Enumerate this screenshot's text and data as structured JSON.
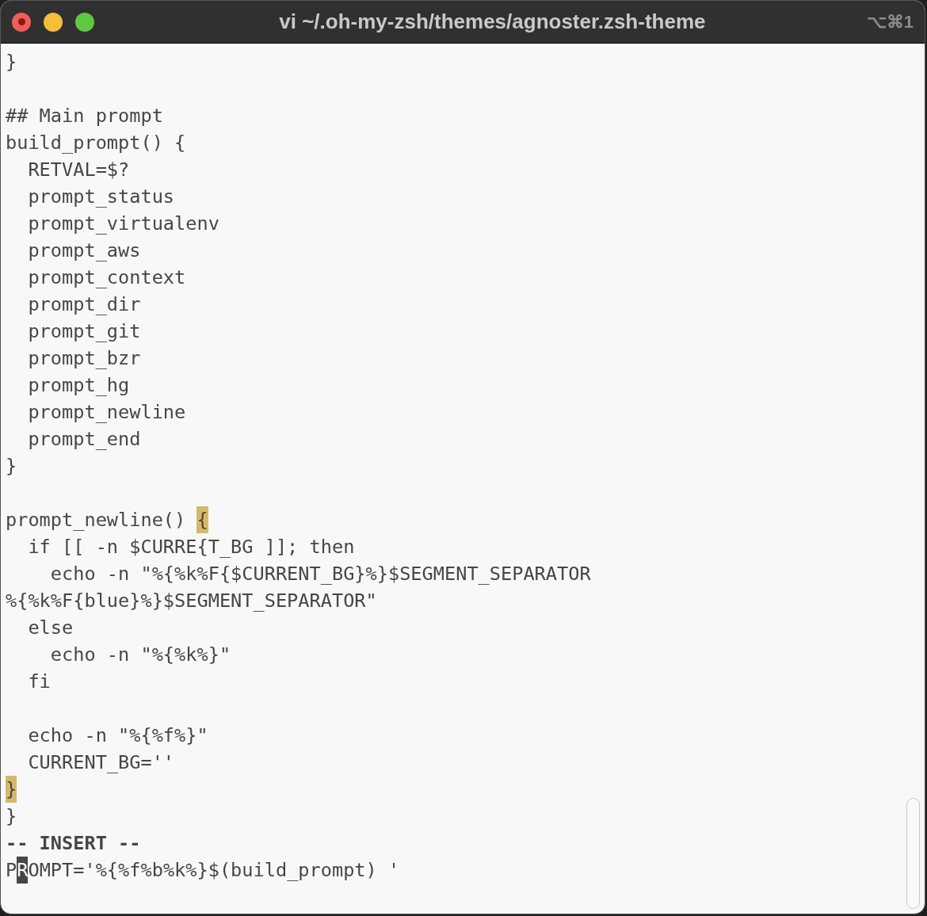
{
  "window": {
    "title": "vi ~/.oh-my-zsh/themes/agnoster.zsh-theme",
    "shortcut": "⌥⌘1"
  },
  "editor": {
    "lines": [
      {
        "kind": "code",
        "segments": [
          {
            "text": "}"
          }
        ]
      },
      {
        "kind": "blank"
      },
      {
        "kind": "code",
        "segments": [
          {
            "text": "## Main prompt"
          }
        ]
      },
      {
        "kind": "code",
        "segments": [
          {
            "text": "build_prompt() {"
          }
        ]
      },
      {
        "kind": "code",
        "segments": [
          {
            "text": "  RETVAL=$?"
          }
        ]
      },
      {
        "kind": "code",
        "segments": [
          {
            "text": "  prompt_status"
          }
        ]
      },
      {
        "kind": "code",
        "segments": [
          {
            "text": "  prompt_virtualenv"
          }
        ]
      },
      {
        "kind": "code",
        "segments": [
          {
            "text": "  prompt_aws"
          }
        ]
      },
      {
        "kind": "code",
        "segments": [
          {
            "text": "  prompt_context"
          }
        ]
      },
      {
        "kind": "code",
        "segments": [
          {
            "text": "  prompt_dir"
          }
        ]
      },
      {
        "kind": "code",
        "segments": [
          {
            "text": "  prompt_git"
          }
        ]
      },
      {
        "kind": "code",
        "segments": [
          {
            "text": "  prompt_bzr"
          }
        ]
      },
      {
        "kind": "code",
        "segments": [
          {
            "text": "  prompt_hg"
          }
        ]
      },
      {
        "kind": "code",
        "segments": [
          {
            "text": "  prompt_newline"
          }
        ]
      },
      {
        "kind": "code",
        "segments": [
          {
            "text": "  prompt_end"
          }
        ]
      },
      {
        "kind": "code",
        "segments": [
          {
            "text": "}"
          }
        ]
      },
      {
        "kind": "blank"
      },
      {
        "kind": "code",
        "segments": [
          {
            "text": "prompt_newline() "
          },
          {
            "text": "{",
            "kind": "match"
          }
        ]
      },
      {
        "kind": "code",
        "segments": [
          {
            "text": "  if [[ -n $CURRE{T_BG ]]; then"
          }
        ]
      },
      {
        "kind": "code",
        "segments": [
          {
            "text": "    echo -n \"%{%k%F{$CURRENT_BG}%}$SEGMENT_SEPARATOR"
          }
        ]
      },
      {
        "kind": "code",
        "segments": [
          {
            "text": "%{%k%F{blue}%}$SEGMENT_SEPARATOR\""
          }
        ]
      },
      {
        "kind": "code",
        "segments": [
          {
            "text": "  else"
          }
        ]
      },
      {
        "kind": "code",
        "segments": [
          {
            "text": "    echo -n \"%{%k%}\""
          }
        ]
      },
      {
        "kind": "code",
        "segments": [
          {
            "text": "  fi"
          }
        ]
      },
      {
        "kind": "blank"
      },
      {
        "kind": "code",
        "segments": [
          {
            "text": "  echo -n \"%{%f%}\""
          }
        ]
      },
      {
        "kind": "code",
        "segments": [
          {
            "text": "  CURRENT_BG=''"
          }
        ]
      },
      {
        "kind": "code",
        "segments": [
          {
            "text": "}",
            "kind": "match"
          }
        ]
      },
      {
        "kind": "code",
        "segments": [
          {
            "text": "}"
          }
        ]
      },
      {
        "kind": "mode",
        "segments": [
          {
            "text": "-- INSERT --"
          }
        ]
      },
      {
        "kind": "code",
        "segments": [
          {
            "text": "P"
          },
          {
            "text": "R",
            "kind": "cursor"
          },
          {
            "text": "OMPT='%{%f%b%k%}$(build_prompt) '"
          }
        ]
      }
    ]
  }
}
